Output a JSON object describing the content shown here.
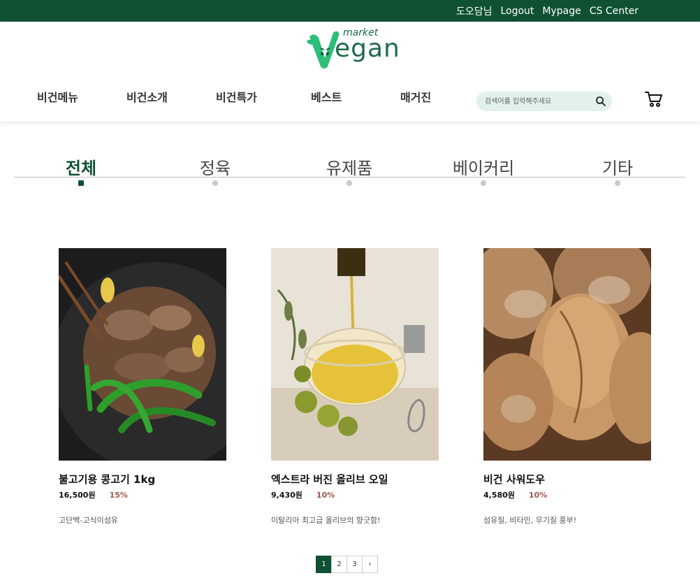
{
  "topbar": {
    "user_name": "도오담님",
    "logout": "Logout",
    "mypage": "Mypage",
    "cs_center": "CS Center"
  },
  "logo": {
    "small": "market",
    "main": "egan"
  },
  "nav": {
    "items": [
      "비건메뉴",
      "비건소개",
      "비건특가",
      "베스트",
      "매거진"
    ]
  },
  "search": {
    "placeholder": "검색어를 입력해주세요"
  },
  "tabs": {
    "items": [
      "전체",
      "정육",
      "유제품",
      "베이커리",
      "기타"
    ],
    "active": "전체"
  },
  "products": [
    {
      "name": "불고기용 콩고기 1kg",
      "price": "16,500원",
      "discount": "15%",
      "desc": "고단백-고식이섬유",
      "image": "stir-fried-soy-meat-with-green-peppers"
    },
    {
      "name": "엑스트라 버진 올리브 오일",
      "price": "9,430원",
      "discount": "10%",
      "desc": "이탈리아 최고급 올리브의 향긋함!",
      "image": "olive-oil-pouring-into-glass-bowl"
    },
    {
      "name": "비건 사워도우",
      "price": "4,580원",
      "discount": "10%",
      "desc": "섬유질, 비타민, 무기질 풍부!",
      "image": "sourdough-bread-loaves"
    }
  ],
  "pagination": {
    "pages": [
      "1",
      "2",
      "3"
    ],
    "current": "1",
    "next": "›"
  },
  "colors": {
    "brand": "#0f5132",
    "search_bg": "#e3f1ee",
    "discount": "#a0584a"
  }
}
